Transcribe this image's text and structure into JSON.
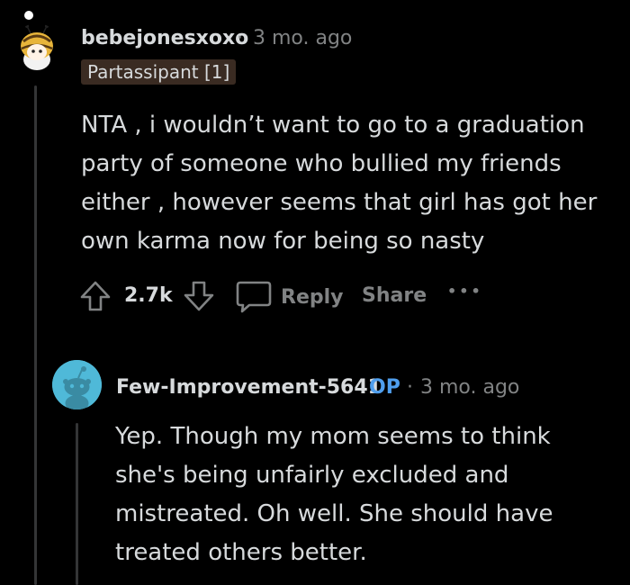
{
  "comment": {
    "username": "bebejonesxoxo",
    "separator": "·",
    "timestamp": "3 mo. ago",
    "flair": "Partassipant [1]",
    "body": "NTA , i wouldn’t want to go to a graduation party of someone who bullied my friends either , however seems that girl has got her own karma now for being so nasty",
    "vote_count": "2.7k",
    "reply_label": "Reply",
    "share_label": "Share",
    "more_label": "•••"
  },
  "reply": {
    "username": "Few-Improvement-5641",
    "op_label": "OP",
    "separator": "·",
    "timestamp": "3 mo. ago",
    "body": "Yep. Though my mom seems to think she's being unfairly excluded and mistreated. Oh well. She should have treated others better."
  },
  "colors": {
    "background": "#000000",
    "text": "#d7dadc",
    "meta": "#818384",
    "op_blue": "#4f9eed",
    "flair_bg": "#3a2b22",
    "avatar_reply_bg": "#4fb9d8"
  }
}
